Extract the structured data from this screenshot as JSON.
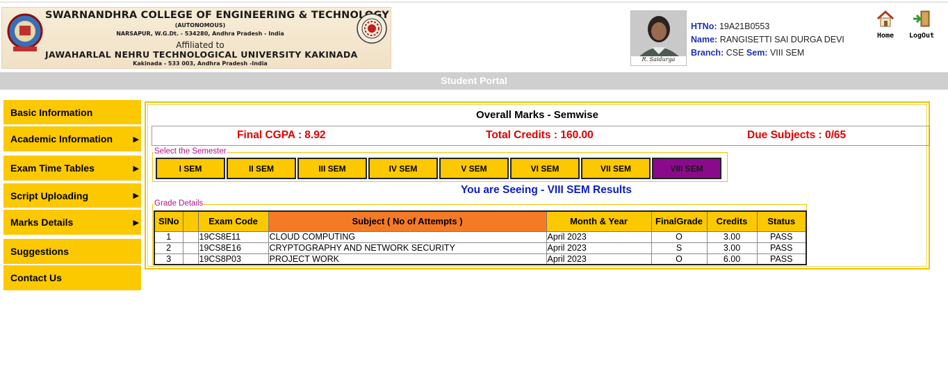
{
  "header": {
    "college_name": "SWARNANDHRA COLLEGE OF ENGINEERING & TECHNOLOGY",
    "autonomous": "(AUTONOMOUS)",
    "address": "NARSAPUR, W.G.Dt. - 534280, Andhra Pradesh - India",
    "affiliated": "Affiliated to",
    "university": "JAWAHARLAL NEHRU TECHNOLOGICAL UNIVERSITY KAKINADA",
    "university_address": "Kakinada - 533 003, Andhra Pradesh -India"
  },
  "student": {
    "htno_label": "HTNo:",
    "htno": "19A21B0553",
    "name_label": "Name:",
    "name": "RANGISETTI SAI DURGA DEVI",
    "branch_label": "Branch:",
    "branch": "CSE",
    "sem_label": "Sem:",
    "sem": "VIII SEM",
    "signature": "R. Saidurga"
  },
  "top_actions": {
    "home_label": "Home",
    "logout_label": "LogOut"
  },
  "portal_title": "Student Portal",
  "sidebar": {
    "items": [
      {
        "label": "Basic Information",
        "has_submenu": false
      },
      {
        "label": "Academic Information",
        "has_submenu": true
      },
      {
        "label": "Exam Time Tables",
        "has_submenu": true
      },
      {
        "label": "Script Uploading",
        "has_submenu": true
      },
      {
        "label": "Marks Details",
        "has_submenu": true
      },
      {
        "label": "Suggestions",
        "has_submenu": false
      },
      {
        "label": "Contact Us",
        "has_submenu": false
      }
    ],
    "arrow_glyph": "▶"
  },
  "main": {
    "title": "Overall Marks - Semwise",
    "cgpa": "Final CGPA : 8.92",
    "total_credits": "Total Credits : 160.00",
    "due_subjects": "Due Subjects : 0/65",
    "semester_legend": "Select the Semester",
    "semesters": [
      "I SEM",
      "II SEM",
      "III SEM",
      "IV SEM",
      "V SEM",
      "VI SEM",
      "VII SEM",
      "VIII SEM"
    ],
    "active_semester": "VIII SEM",
    "seeing_text": "You are Seeing - VIII SEM Results",
    "grade_legend": "Grade Details"
  },
  "grades": {
    "headers": {
      "slno": "SlNo",
      "blank": "",
      "code": "Exam Code",
      "subject": "Subject ( No of Attempts )",
      "month": "Month & Year",
      "grade": "FinalGrade",
      "credits": "Credits",
      "status": "Status"
    },
    "rows": [
      {
        "slno": "1",
        "code": "19CS8E11",
        "subject": "CLOUD COMPUTING",
        "month": "April 2023",
        "grade": "O",
        "credits": "3.00",
        "status": "PASS"
      },
      {
        "slno": "2",
        "code": "19CS8E16",
        "subject": "CRYPTOGRAPHY AND NETWORK SECURITY",
        "month": "April 2023",
        "grade": "S",
        "credits": "3.00",
        "status": "PASS"
      },
      {
        "slno": "3",
        "code": "19CS8P03",
        "subject": "PROJECT WORK",
        "month": "April 2023",
        "grade": "O",
        "credits": "6.00",
        "status": "PASS"
      }
    ]
  },
  "colors": {
    "accent_yellow": "#fcc800",
    "active_sem": "#8b0a8b",
    "subject_header": "#f57a26",
    "summary_red": "#e00000",
    "label_blue": "#1e2fb4"
  }
}
